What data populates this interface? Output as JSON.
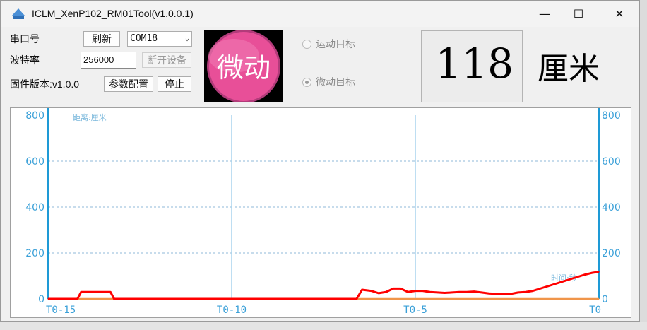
{
  "window": {
    "title": "ICLM_XenP102_RM01Tool(v1.0.0.1)",
    "minimize": "—",
    "maximize": "☐",
    "close": "✕",
    "icon": "app-logo-icon"
  },
  "controls": {
    "port_label": "串口号",
    "refresh_button": "刷新",
    "port_value": "COM18",
    "baud_label": "波特率",
    "baud_value": "256000",
    "disconnect_button": "断开设备",
    "firmware_label": "固件版本:v1.0.0",
    "config_button": "参数配置",
    "stop_button": "停止"
  },
  "status": {
    "badge_text": "微动",
    "badge_color": "#e84f98",
    "radio_motion": "运动目标",
    "radio_micro": "微动目标",
    "distance_value": "118",
    "distance_unit": "厘米"
  },
  "chart_data": {
    "type": "line",
    "title": "",
    "ylabel": "距离:厘米",
    "xlabel": "时间:秒",
    "ylim": [
      0,
      800
    ],
    "y_ticks": [
      "0",
      "200",
      "400",
      "600",
      "800"
    ],
    "x_ticks": [
      "T0-15",
      "T0-10",
      "T0-5",
      "T0"
    ],
    "xlim": [
      -15,
      0
    ],
    "grid": true,
    "series": [
      {
        "color": "#ff0000",
        "x": [
          -15.0,
          -14.2,
          -14.1,
          -13.3,
          -13.2,
          -6.6,
          -6.45,
          -6.2,
          -6.0,
          -5.8,
          -5.6,
          -5.4,
          -5.2,
          -5.0,
          -4.8,
          -4.6,
          -4.4,
          -4.2,
          -4.0,
          -3.8,
          -3.6,
          -3.4,
          -3.2,
          -3.0,
          -2.8,
          -2.6,
          -2.4,
          -2.2,
          -2.0,
          -1.8,
          -1.6,
          -1.4,
          -1.2,
          -1.0,
          -0.8,
          -0.6,
          -0.4,
          -0.2,
          0.0
        ],
        "y": [
          0,
          0,
          30,
          30,
          0,
          0,
          40,
          35,
          25,
          30,
          45,
          45,
          30,
          35,
          35,
          30,
          28,
          26,
          28,
          30,
          30,
          32,
          28,
          24,
          22,
          20,
          22,
          28,
          30,
          35,
          45,
          55,
          65,
          75,
          85,
          95,
          105,
          113,
          118
        ]
      },
      {
        "color": "#f0954a",
        "x": [
          -15,
          0
        ],
        "y": [
          0,
          0
        ]
      }
    ]
  }
}
